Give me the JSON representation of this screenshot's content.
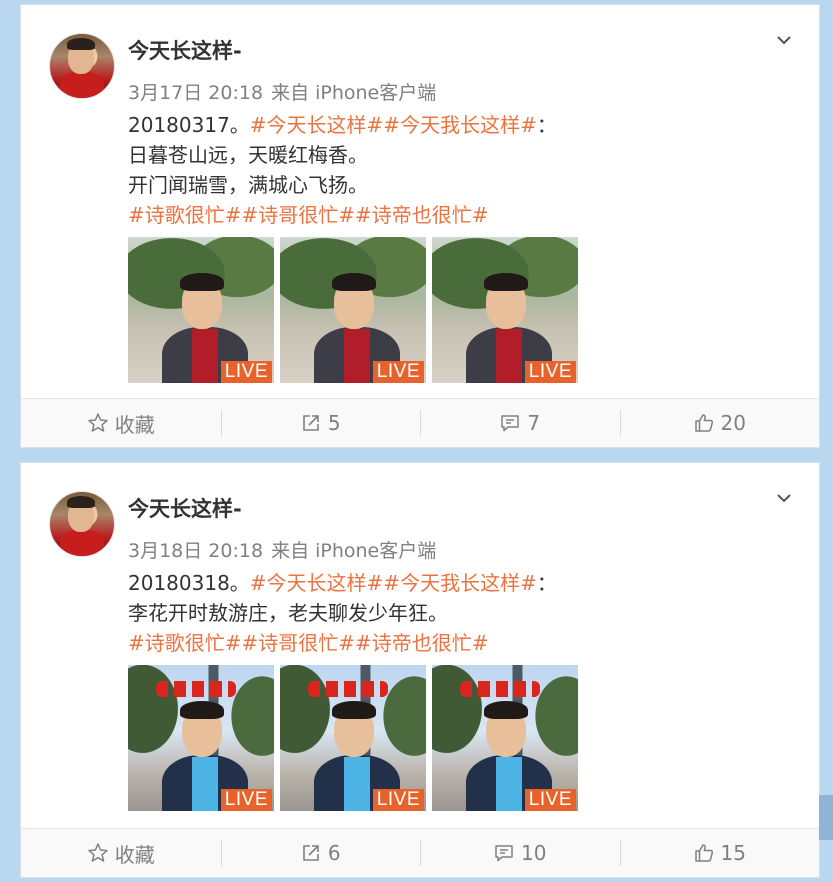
{
  "posts": [
    {
      "username": "今天长这样-",
      "date": "3月17日 20:18",
      "source": "来自 iPhone客户端",
      "lines": [
        [
          {
            "t": "20180317。"
          },
          {
            "t": "#今天长这样##今天我长这样#",
            "tag": true
          },
          {
            "t": "："
          }
        ],
        [
          {
            "t": "日暮苍山远，天暖红梅香。"
          }
        ],
        [
          {
            "t": "开门闻瑞雪，满城心飞扬。"
          }
        ],
        [
          {
            "t": "#诗歌很忙##诗哥很忙##诗帝也很忙#",
            "tag": true
          }
        ]
      ],
      "photos": [
        "LIVE",
        "LIVE",
        "LIVE"
      ],
      "actions": {
        "favorite": "收藏",
        "repost": "5",
        "comment": "7",
        "like": "20"
      }
    },
    {
      "username": "今天长这样-",
      "date": "3月18日 20:18",
      "source": "来自 iPhone客户端",
      "lines": [
        [
          {
            "t": "20180318。"
          },
          {
            "t": "#今天长这样##今天我长这样#",
            "tag": true
          },
          {
            "t": "："
          }
        ],
        [
          {
            "t": "李花开时敖游庄，老夫聊发少年狂。"
          }
        ],
        [
          {
            "t": "#诗歌很忙##诗哥很忙##诗帝也很忙#",
            "tag": true
          }
        ]
      ],
      "photos": [
        "LIVE",
        "LIVE",
        "LIVE"
      ],
      "actions": {
        "favorite": "收藏",
        "repost": "6",
        "comment": "10",
        "like": "15"
      }
    }
  ],
  "colors": {
    "tag": "#eb7340",
    "live_badge": "#e8632c",
    "background": "#b9d7ee"
  },
  "icons": {
    "menu": "chevron-down-icon",
    "favorite": "star-icon",
    "repost": "share-icon",
    "comment": "comment-icon",
    "like": "thumbs-up-icon"
  }
}
